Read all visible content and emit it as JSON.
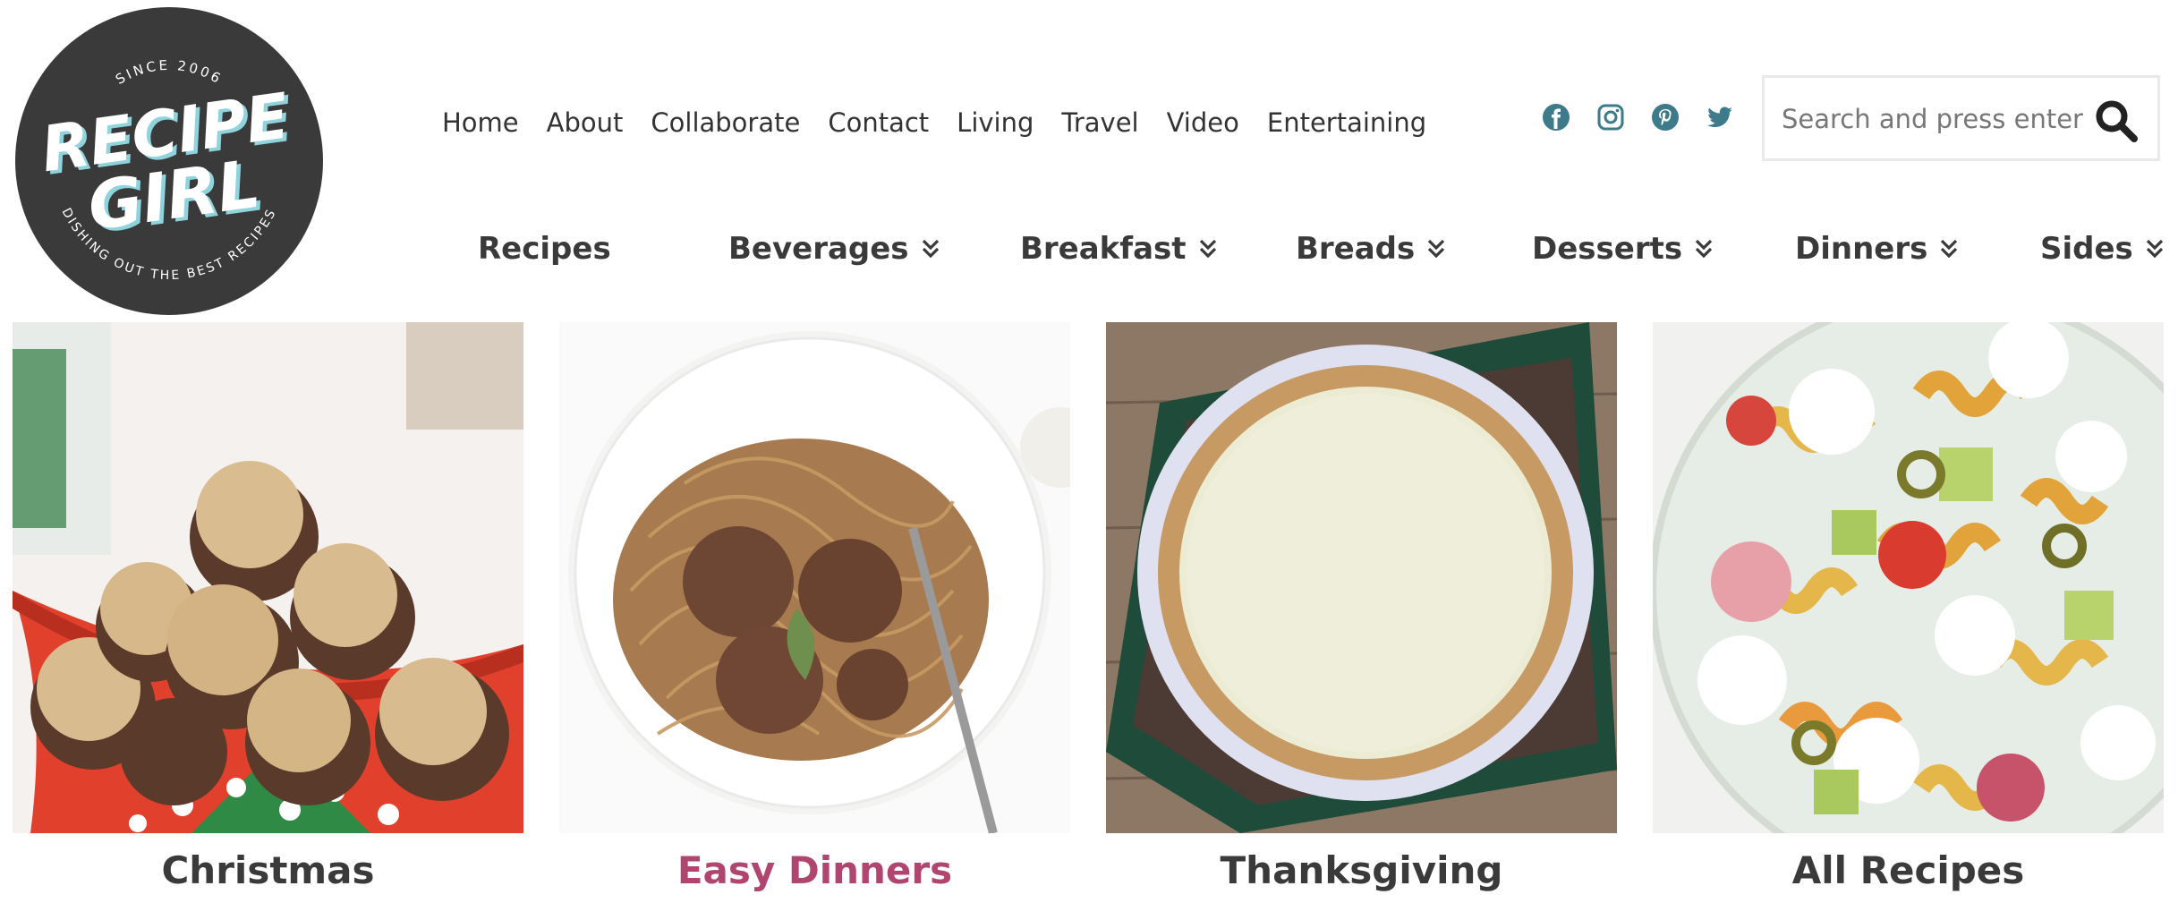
{
  "logo": {
    "top_text": "SINCE 2006",
    "line1": "RECIPE",
    "line2": "GIRL",
    "bottom_text": "DISHING OUT THE BEST RECIPES"
  },
  "topnav": [
    "Home",
    "About",
    "Collaborate",
    "Contact",
    "Living",
    "Travel",
    "Video",
    "Entertaining"
  ],
  "social": [
    "facebook-icon",
    "instagram-icon",
    "pinterest-icon",
    "twitter-icon"
  ],
  "search": {
    "placeholder": "Search and press enter"
  },
  "categories": [
    {
      "label": "Recipes",
      "has_dropdown": false
    },
    {
      "label": "Beverages",
      "has_dropdown": true
    },
    {
      "label": "Breakfast",
      "has_dropdown": true
    },
    {
      "label": "Breads",
      "has_dropdown": true
    },
    {
      "label": "Desserts",
      "has_dropdown": true
    },
    {
      "label": "Dinners",
      "has_dropdown": true
    },
    {
      "label": "Sides",
      "has_dropdown": true
    }
  ],
  "tiles": [
    {
      "caption": "Christmas"
    },
    {
      "caption": "Easy Dinners"
    },
    {
      "caption": "Thanksgiving"
    },
    {
      "caption": "All Recipes"
    }
  ],
  "colors": {
    "social": "#3d7a8a",
    "accent": "#b0456f",
    "text": "#3a3a3a"
  }
}
